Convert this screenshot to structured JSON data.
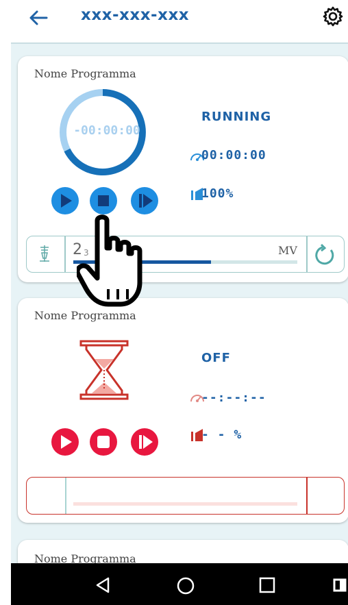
{
  "header": {
    "title": "xxx-xxx-xxx",
    "back_icon": "arrow-left-icon",
    "settings_icon": "gear-icon"
  },
  "programs": [
    {
      "name": "Nome Programma",
      "timer": "-00:00:00",
      "status": "RUNNING",
      "elapsed": "00:00:00",
      "percent": "100%",
      "slider_value": "2",
      "slider_value_small": "3",
      "unit": "MV",
      "progress_fraction": 0.75,
      "colors": {
        "accent": "#1f62a6",
        "button": "#1e8ee2"
      }
    },
    {
      "name": "Nome Programma",
      "status": "OFF",
      "elapsed": "--:--:--",
      "percent": "- - %",
      "colors": {
        "accent": "#c8322a",
        "button": "#e8173f"
      }
    },
    {
      "name": "Nome Programma"
    }
  ],
  "navbar": {
    "icons": [
      "back-triangle-icon",
      "home-circle-icon",
      "recents-square-icon",
      "edge-icon"
    ]
  }
}
